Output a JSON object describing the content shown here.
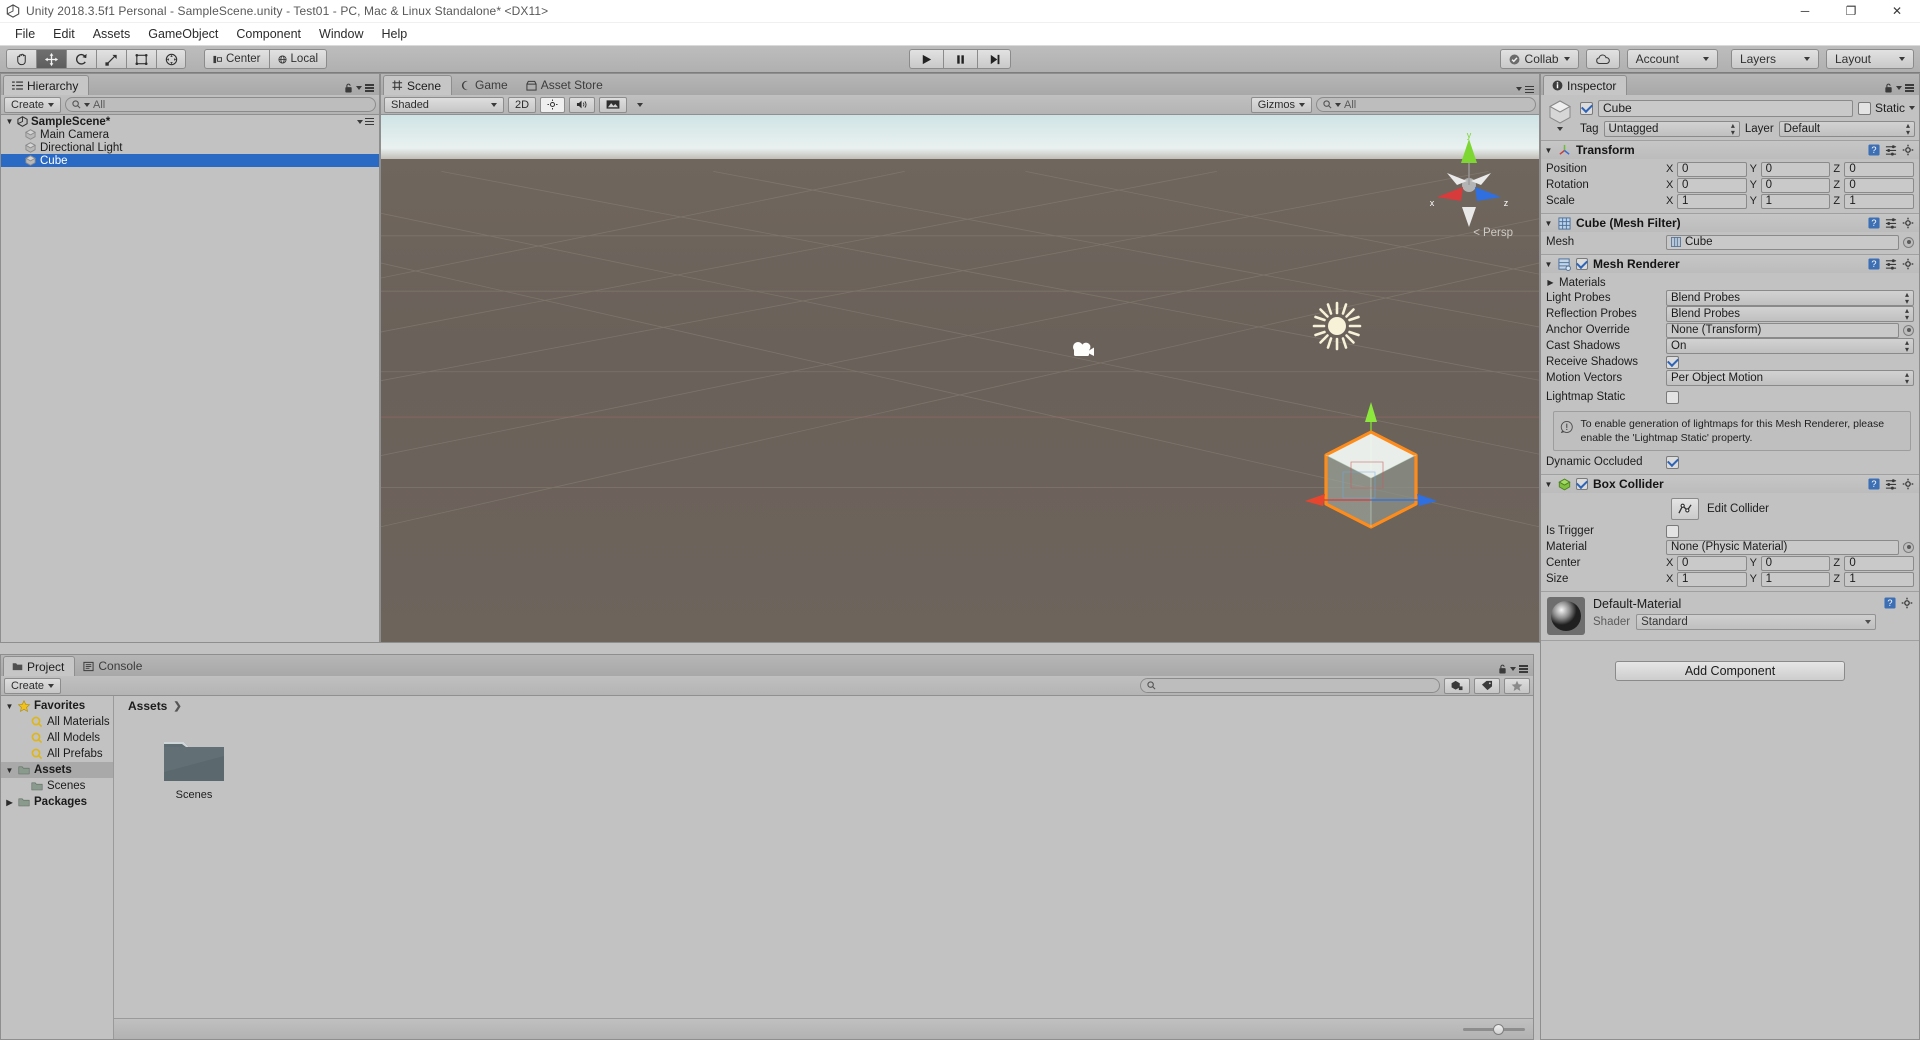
{
  "window": {
    "title": "Unity 2018.3.5f1 Personal - SampleScene.unity - Test01 - PC, Mac & Linux Standalone* <DX11>",
    "minimize": "─",
    "maximize": "❐",
    "close": "✕"
  },
  "menu": {
    "items": [
      "File",
      "Edit",
      "Assets",
      "GameObject",
      "Component",
      "Window",
      "Help"
    ]
  },
  "toolbar": {
    "tools": [
      {
        "name": "hand-tool",
        "glyph": "✋",
        "active": false
      },
      {
        "name": "move-tool",
        "glyph": "✚",
        "active": true
      },
      {
        "name": "rotate-tool",
        "glyph": "↺",
        "active": false
      },
      {
        "name": "scale-tool",
        "glyph": "⤢",
        "active": false
      },
      {
        "name": "rect-tool",
        "glyph": "▣",
        "active": false
      },
      {
        "name": "transform-tool",
        "glyph": "◆",
        "active": false
      }
    ],
    "pivot_label": "Center",
    "space_label": "Local",
    "play": "▶",
    "pause": "❚❚",
    "step": "▶|",
    "collab_label": "Collab",
    "cloud_label": "",
    "account_label": "Account",
    "layers_label": "Layers",
    "layout_label": "Layout"
  },
  "hierarchy": {
    "tab_label": "Hierarchy",
    "create_label": "Create",
    "search_placeholder": "All",
    "scene_name": "SampleScene*",
    "objects": [
      {
        "label": "Main Camera",
        "selected": false
      },
      {
        "label": "Directional Light",
        "selected": false
      },
      {
        "label": "Cube",
        "selected": true
      }
    ]
  },
  "scene": {
    "tabs": [
      {
        "label": "Scene",
        "icon": "grid-icon",
        "selected": true
      },
      {
        "label": "Game",
        "icon": "gamepad-icon",
        "selected": false
      },
      {
        "label": "Asset Store",
        "icon": "store-icon",
        "selected": false
      }
    ],
    "draw_mode": "Shaded",
    "mode_2d": "2D",
    "gizmos_label": "Gizmos",
    "search_placeholder": "All",
    "camera_mode": "Persp",
    "axis_x": "x",
    "axis_y": "y",
    "axis_z": "z"
  },
  "project": {
    "tabs": [
      {
        "label": "Project",
        "icon": "folder-icon",
        "selected": true
      },
      {
        "label": "Console",
        "icon": "console-icon",
        "selected": false
      }
    ],
    "create_label": "Create",
    "search_placeholder": "",
    "tree": [
      {
        "label": "Favorites",
        "bold": true,
        "indent": 0,
        "icon": "star-icon",
        "expanded": true
      },
      {
        "label": "All Materials",
        "bold": false,
        "indent": 1,
        "icon": "search-icon",
        "expanded": null
      },
      {
        "label": "All Models",
        "bold": false,
        "indent": 1,
        "icon": "search-icon",
        "expanded": null
      },
      {
        "label": "All Prefabs",
        "bold": false,
        "indent": 1,
        "icon": "search-icon",
        "expanded": null
      },
      {
        "label": "Assets",
        "bold": true,
        "indent": 0,
        "icon": "folder-icon",
        "expanded": true,
        "selected": true
      },
      {
        "label": "Scenes",
        "bold": false,
        "indent": 1,
        "icon": "folder-icon",
        "expanded": null
      },
      {
        "label": "Packages",
        "bold": true,
        "indent": 0,
        "icon": "folder-icon",
        "expanded": false
      }
    ],
    "breadcrumb": "Assets",
    "assets": [
      {
        "label": "Scenes",
        "type": "folder"
      }
    ]
  },
  "inspector": {
    "tab_label": "Inspector",
    "object_name": "Cube",
    "enabled": true,
    "static_label": "Static",
    "tag_label": "Tag",
    "tag_value": "Untagged",
    "layer_label": "Layer",
    "layer_value": "Default",
    "transform": {
      "title": "Transform",
      "rows": [
        {
          "name": "Position",
          "x": "0",
          "y": "0",
          "z": "0"
        },
        {
          "name": "Rotation",
          "x": "0",
          "y": "0",
          "z": "0"
        },
        {
          "name": "Scale",
          "x": "1",
          "y": "1",
          "z": "1"
        }
      ]
    },
    "mesh_filter": {
      "title": "Cube (Mesh Filter)",
      "mesh_label": "Mesh",
      "mesh_value": "Cube"
    },
    "mesh_renderer": {
      "title": "Mesh Renderer",
      "enabled": true,
      "materials_label": "Materials",
      "light_probes_label": "Light Probes",
      "light_probes_value": "Blend Probes",
      "reflection_probes_label": "Reflection Probes",
      "reflection_probes_value": "Blend Probes",
      "anchor_override_label": "Anchor Override",
      "anchor_override_value": "None (Transform)",
      "cast_shadows_label": "Cast Shadows",
      "cast_shadows_value": "On",
      "receive_shadows_label": "Receive Shadows",
      "receive_shadows_value": true,
      "motion_vectors_label": "Motion Vectors",
      "motion_vectors_value": "Per Object Motion",
      "lightmap_static_label": "Lightmap Static",
      "lightmap_static_value": false,
      "help_text": "To enable generation of lightmaps for this Mesh Renderer, please enable the 'Lightmap Static' property.",
      "dynamic_occluded_label": "Dynamic Occluded",
      "dynamic_occluded_value": true
    },
    "box_collider": {
      "title": "Box Collider",
      "enabled": true,
      "edit_collider_label": "Edit Collider",
      "is_trigger_label": "Is Trigger",
      "is_trigger_value": false,
      "material_label": "Material",
      "material_value": "None (Physic Material)",
      "rows": [
        {
          "name": "Center",
          "x": "0",
          "y": "0",
          "z": "0"
        },
        {
          "name": "Size",
          "x": "1",
          "y": "1",
          "z": "1"
        }
      ]
    },
    "material": {
      "name": "Default-Material",
      "shader_label": "Shader",
      "shader_value": "Standard"
    },
    "add_component_label": "Add Component"
  },
  "colors": {
    "selection_blue": "#2b6ac4",
    "gizmo_orange": "#ff8c1a",
    "axis_x": "#d83b3b",
    "axis_y": "#7dd631",
    "axis_z": "#2f6fe0",
    "panel_gray": "#c2c2c2",
    "toolbar_gray": "#b3b3b3"
  }
}
